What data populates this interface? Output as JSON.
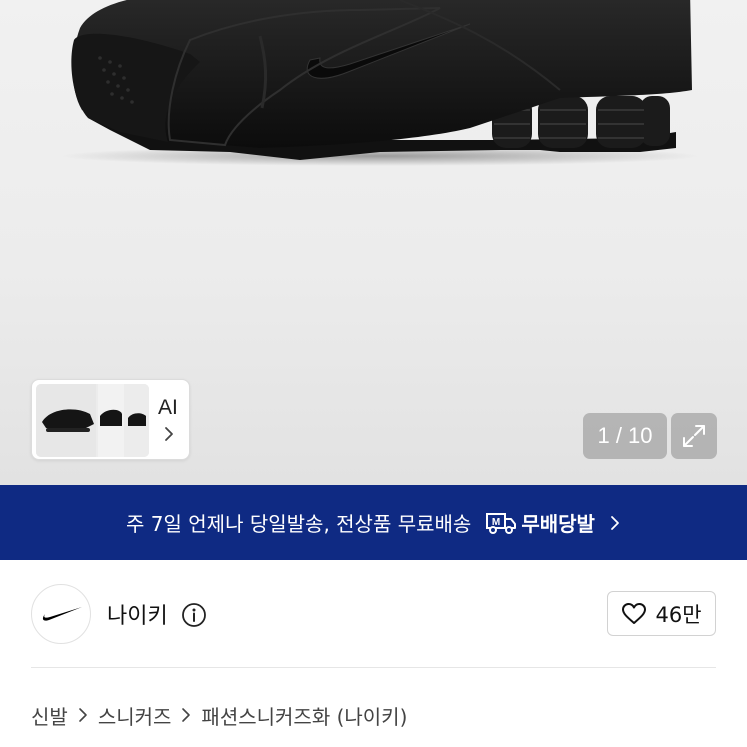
{
  "gallery": {
    "thumbnail_label": "AI",
    "counter": "1 / 10",
    "current_image": 1,
    "total_images": 10
  },
  "banner": {
    "message": "주 7일 언제나 당일발송, 전상품 무료배송",
    "badge_letter": "M",
    "brand_label": "무배당발",
    "background_color": "#0f2a83"
  },
  "store": {
    "name": "나이키",
    "logo_icon": "nike-swoosh-icon",
    "likes": "46만"
  },
  "breadcrumb": {
    "items": [
      "신발",
      "스니커즈",
      "패션스니커즈화 (나이키)"
    ]
  }
}
